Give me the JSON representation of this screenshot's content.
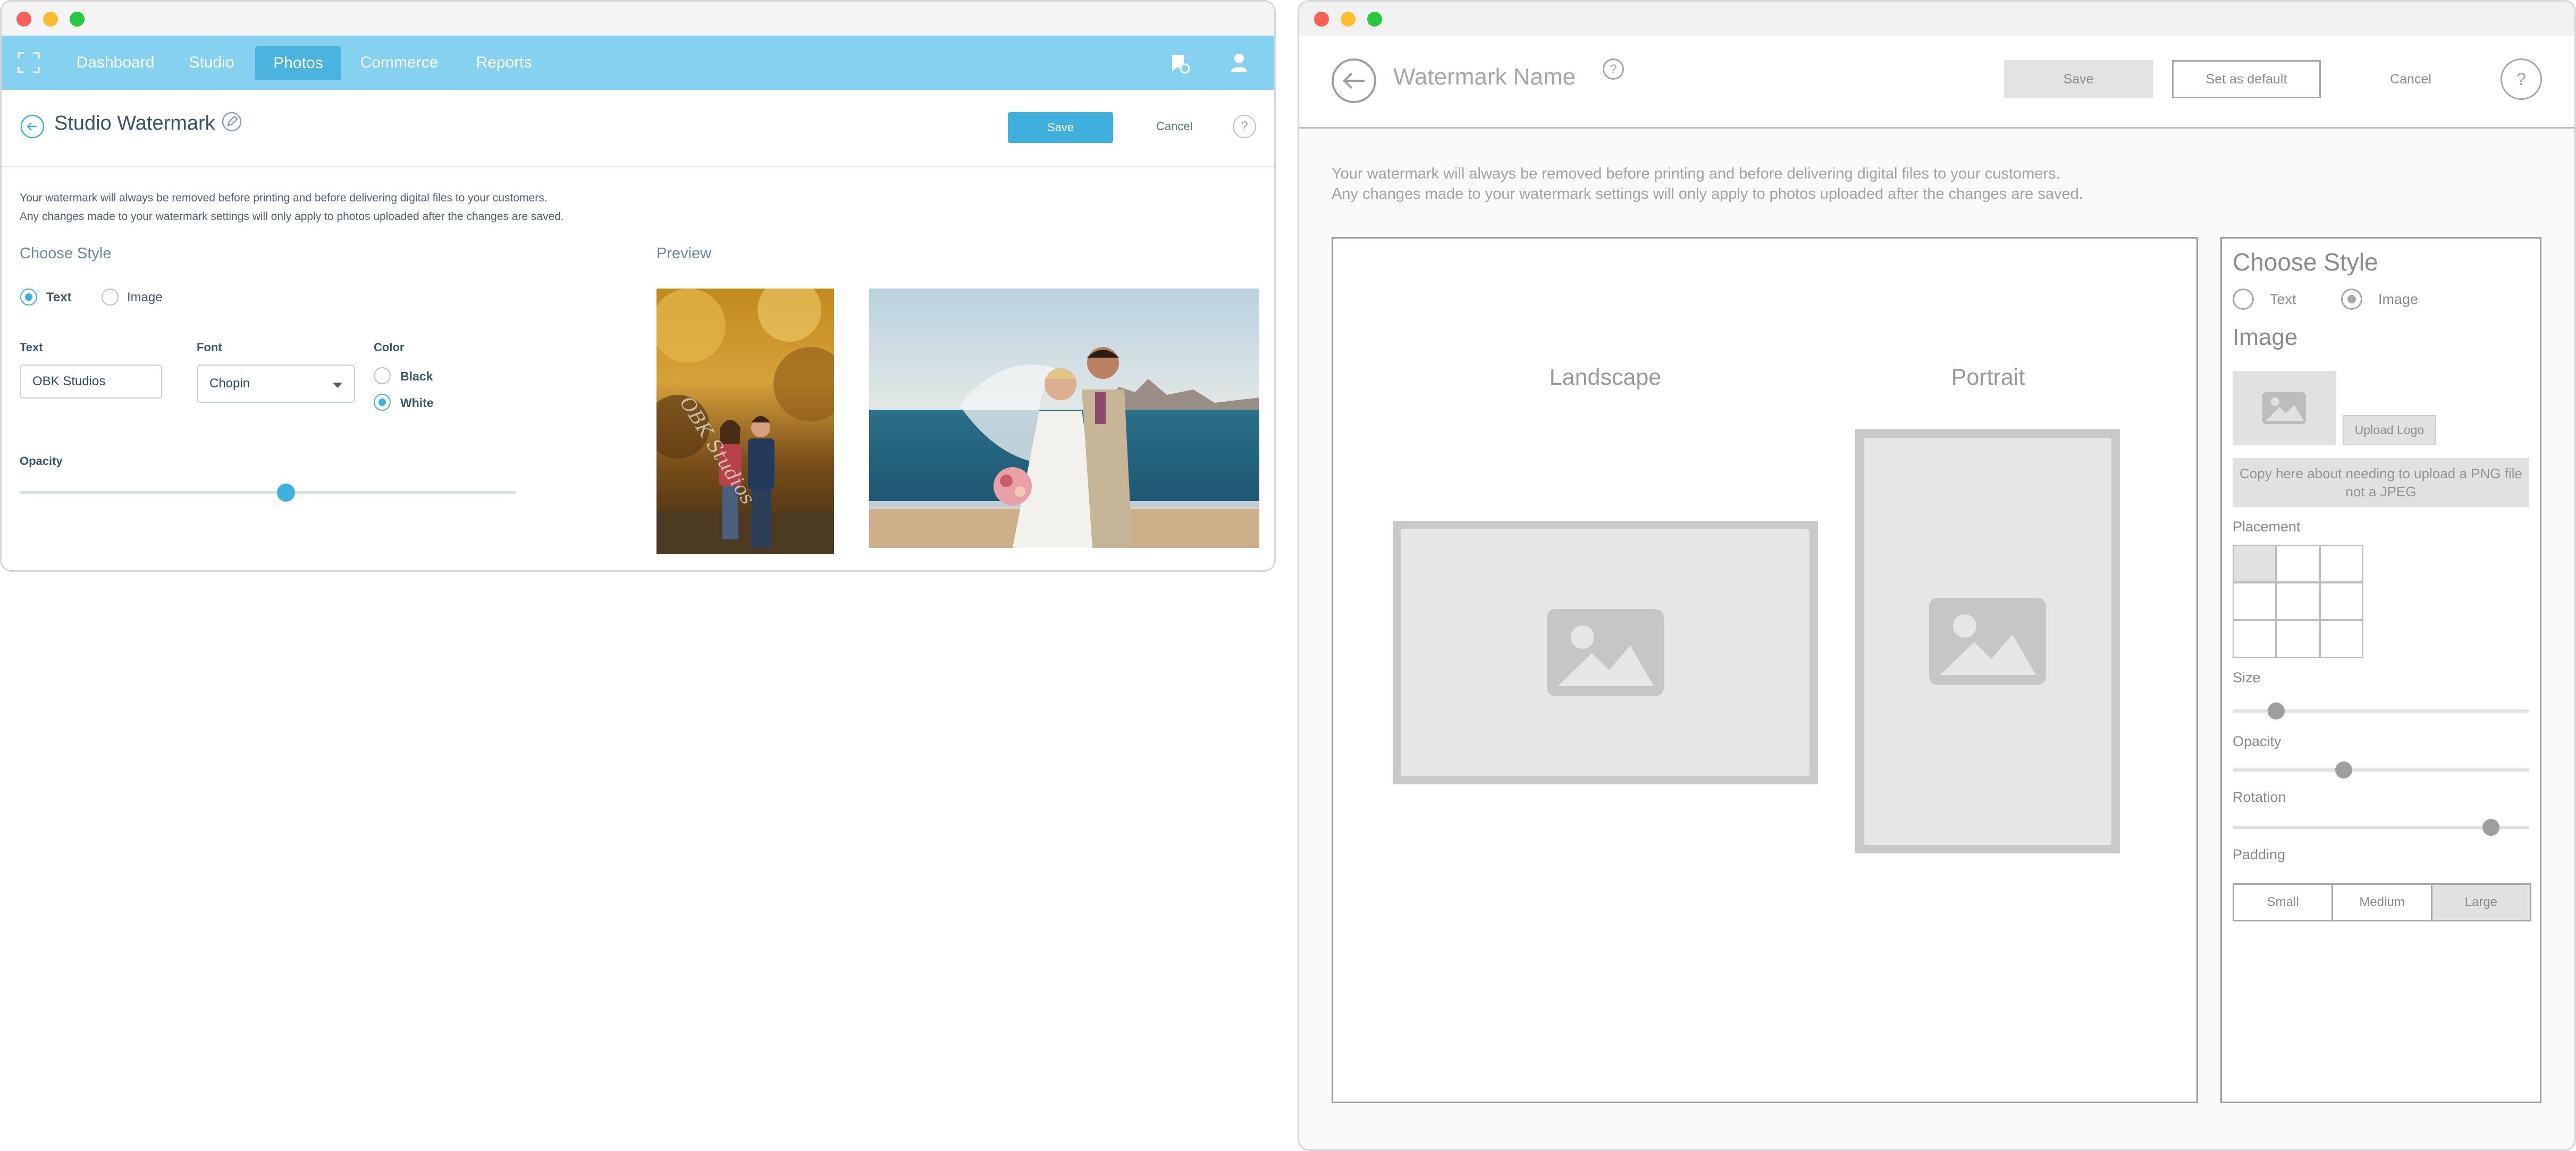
{
  "left_window": {
    "nav": {
      "items": [
        "Dashboard",
        "Studio",
        "Photos",
        "Commerce",
        "Reports"
      ],
      "active": "Photos"
    },
    "header": {
      "title": "Studio Watermark",
      "save_label": "Save",
      "cancel_label": "Cancel",
      "help_label": "?"
    },
    "notice": {
      "line1": "Your watermark will always be removed before printing and before delivering digital files to your customers.",
      "line2": "Any changes made to your watermark settings will only apply to photos uploaded after the changes are saved."
    },
    "choose_style": {
      "heading": "Choose Style",
      "text_option": "Text",
      "image_option": "Image",
      "selected": "Text"
    },
    "fields": {
      "text_label": "Text",
      "text_value": "OBK Studios",
      "font_label": "Font",
      "font_value": "Chopin",
      "color_label": "Color",
      "color_black": "Black",
      "color_white": "White",
      "color_selected": "White",
      "opacity_label": "Opacity",
      "opacity_value": 0.54
    },
    "preview": {
      "heading": "Preview",
      "watermark_text": "OBK Studios"
    }
  },
  "right_window": {
    "header": {
      "title": "Watermark Name",
      "title_help": "?",
      "save_label": "Save",
      "set_default_label": "Set as default",
      "cancel_label": "Cancel",
      "help_label": "?"
    },
    "notice": {
      "line1": "Your watermark will always be removed before printing and before delivering digital files to your customers.",
      "line2": "Any changes made to your watermark settings will only apply to photos uploaded after the changes are saved."
    },
    "preview": {
      "landscape_label": "Landscape",
      "portrait_label": "Portrait"
    },
    "panel": {
      "heading": "Choose Style",
      "text_option": "Text",
      "image_option": "Image",
      "selected": "Image",
      "image_heading": "Image",
      "upload_label": "Upload Logo",
      "png_note": "Copy here about needing to upload a PNG file not a JPEG",
      "placement_label": "Placement",
      "placement_selected": "top-left",
      "size_label": "Size",
      "size_value": 0.05,
      "opacity_label": "Opacity",
      "opacity_value": 0.37,
      "rotation_label": "Rotation",
      "rotation_value": 0.86,
      "padding_label": "Padding",
      "padding_options": [
        "Small",
        "Medium",
        "Large"
      ],
      "padding_selected": "Large"
    }
  },
  "colors": {
    "nav_bar": "#86d1ef",
    "nav_active": "#4ab3de",
    "primary_button": "#3fb0dd",
    "text_dark": "#4f6b80",
    "wireframe_gray": "#9e9e9e"
  }
}
